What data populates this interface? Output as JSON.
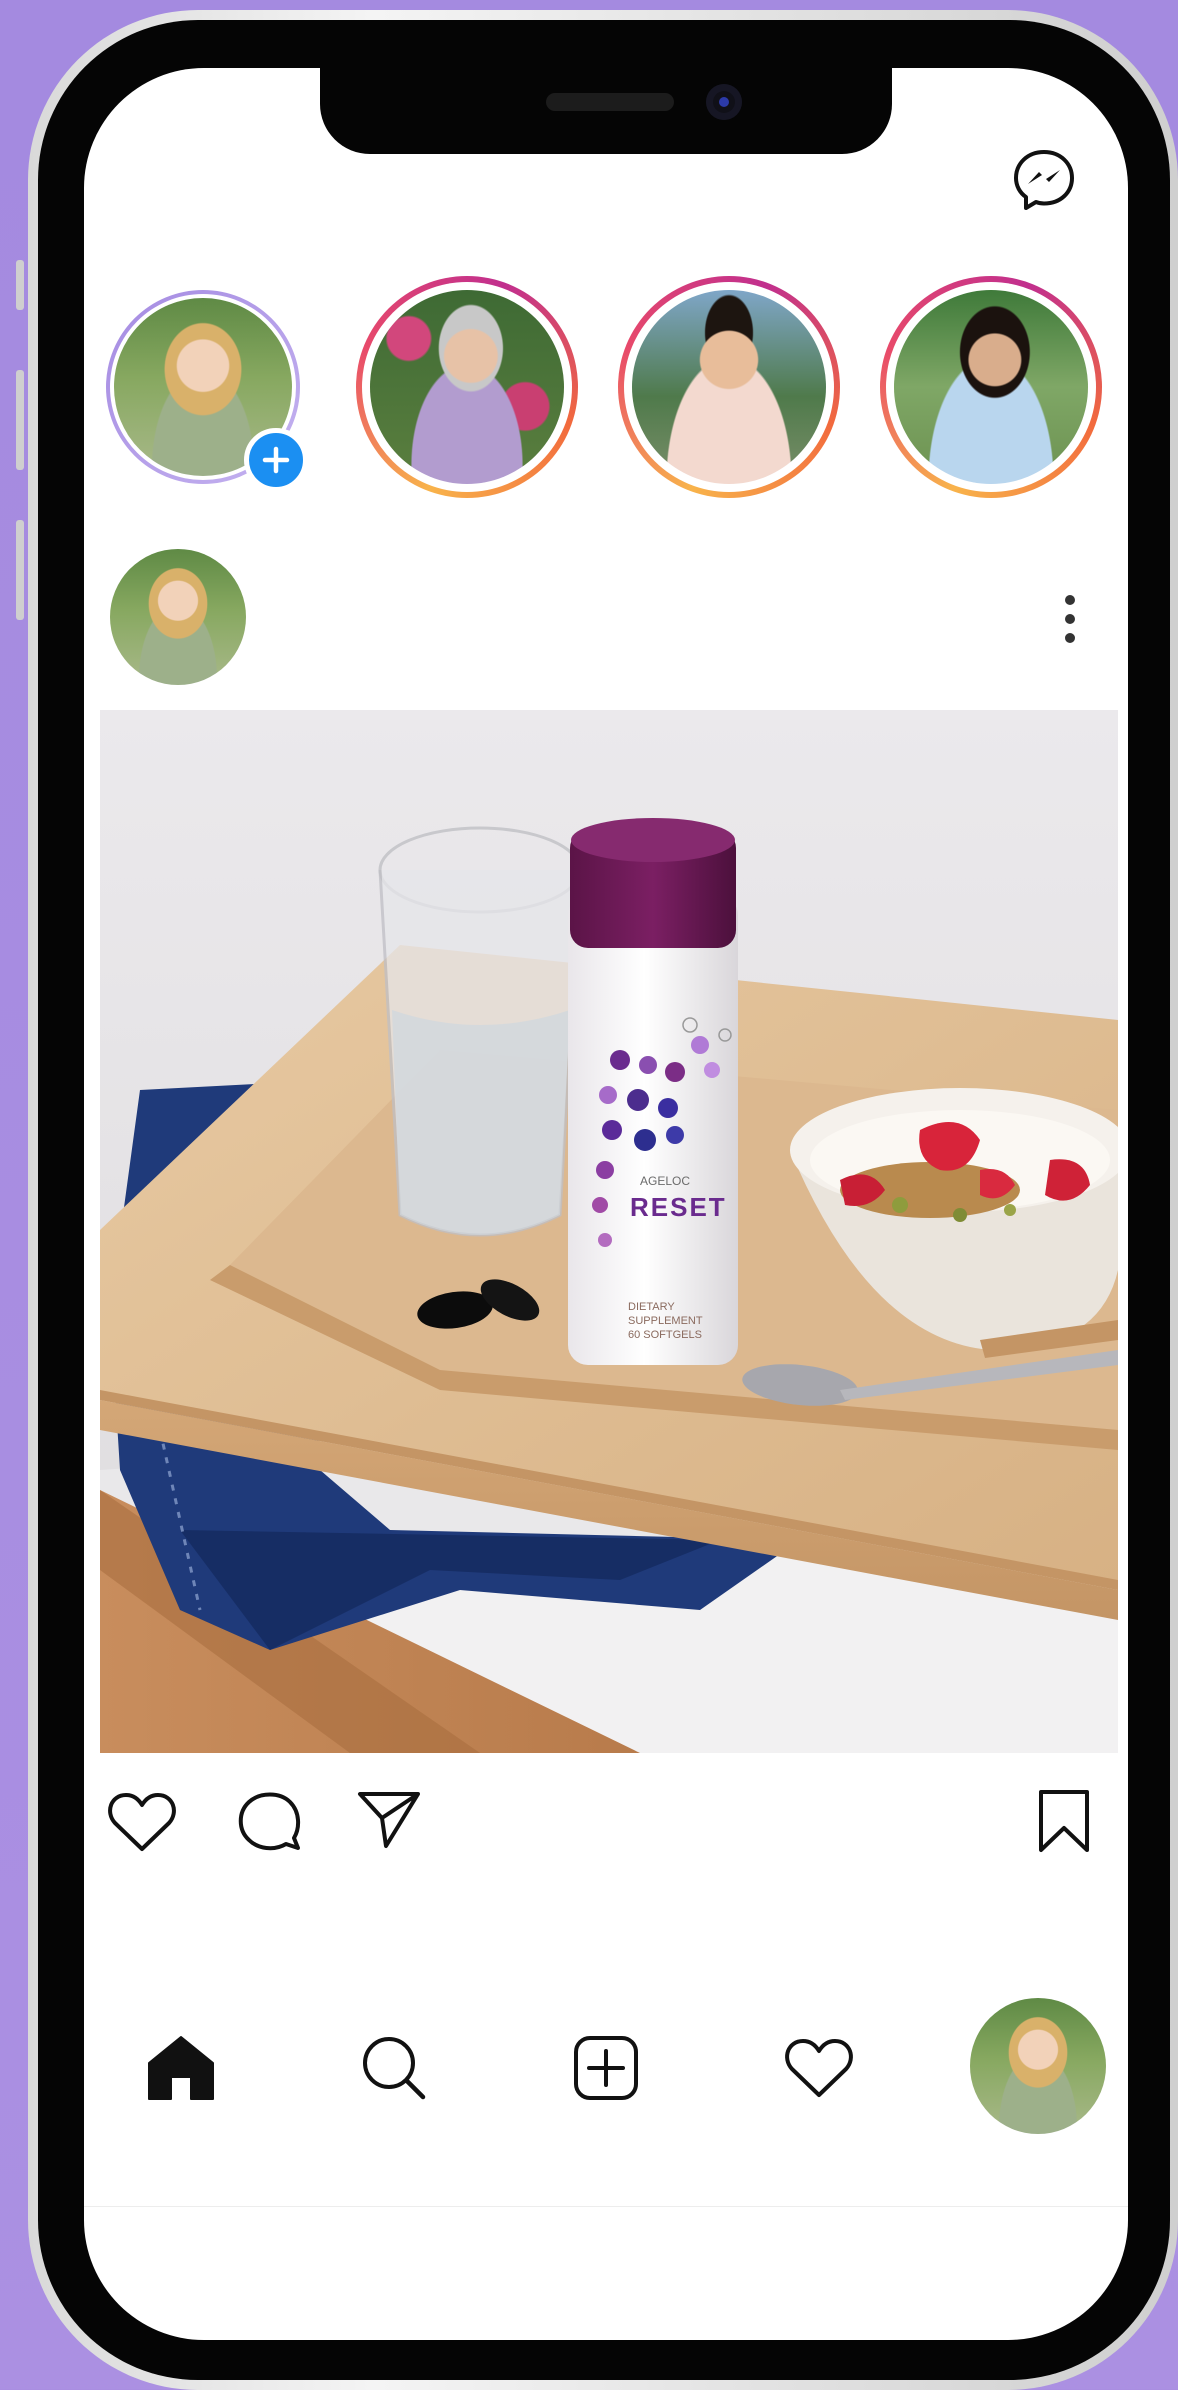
{
  "colors": {
    "background": "#a98ee0",
    "accent_blue": "#1b8ff2",
    "icon_black": "#111111",
    "story_ring": "#e84a6a"
  },
  "header": {
    "messenger_icon": "messenger-icon"
  },
  "stories": [
    {
      "avatar": "avatar-blonde-woman",
      "own": true,
      "badge": "plus-icon"
    },
    {
      "avatar": "avatar-grey-haired-woman",
      "own": false
    },
    {
      "avatar": "avatar-man",
      "own": false
    },
    {
      "avatar": "avatar-dark-haired-woman",
      "own": false
    }
  ],
  "post": {
    "author_avatar": "avatar-blonde-woman",
    "more_icon": "more-vertical-icon",
    "product": {
      "brand": "AGELOC",
      "name": "RESET",
      "line1": "DIETARY",
      "line2": "SUPPLEMENT",
      "line3": "60 SOFTGELS"
    },
    "actions": {
      "like": "heart-icon",
      "comment": "comment-icon",
      "share": "send-icon",
      "save": "bookmark-icon"
    }
  },
  "bottom_nav": {
    "items": [
      "home-icon",
      "search-icon",
      "new-post-icon",
      "activity-icon",
      "profile-avatar"
    ]
  }
}
